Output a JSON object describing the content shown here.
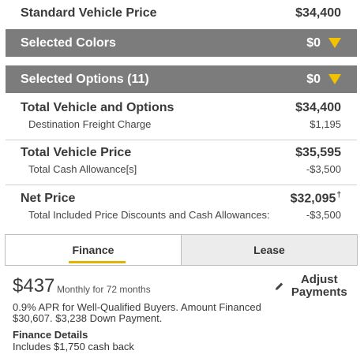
{
  "standard_vehicle_price": {
    "label": "Standard Vehicle Price",
    "value": "$34,400"
  },
  "selected_colors": {
    "label": "Selected Colors",
    "value": "$0"
  },
  "selected_options": {
    "label": "Selected Options (11)",
    "value": "$0"
  },
  "total_vehicle_and_options": {
    "label": "Total Vehicle and Options",
    "value": "$34,400"
  },
  "destination_freight": {
    "label": "Destination Freight Charge",
    "value": "$1,195"
  },
  "total_vehicle_price": {
    "label": "Total Vehicle Price",
    "value": "$35,595"
  },
  "total_cash_allowance": {
    "label": "Total Cash Allowance[s]",
    "value": "-$3,500"
  },
  "net_price": {
    "label": "Net Price",
    "value": "$32,095",
    "footnote": "†"
  },
  "total_discounts": {
    "label": "Total Included Price Discounts and Cash Allowances:",
    "value": "-$3,500"
  },
  "tabs": {
    "finance": "Finance",
    "lease": "Lease"
  },
  "payment": {
    "amount": "$437",
    "term": "Monthly for 72  months",
    "adjust_label": "Adjust Payments",
    "apr_text": "0.9% APR for Well-Qualified Buyers. Amount Financed $30,607. $3,238 Down Payment.",
    "details_title": "Finance Details",
    "details_text": "Includes $1,750 cash back"
  },
  "colors": {
    "bar_bg": "#7c7c7c",
    "accent": "#f2c200"
  },
  "icons": {
    "dropdown": "triangle-down-icon",
    "edit": "pencil-icon"
  }
}
